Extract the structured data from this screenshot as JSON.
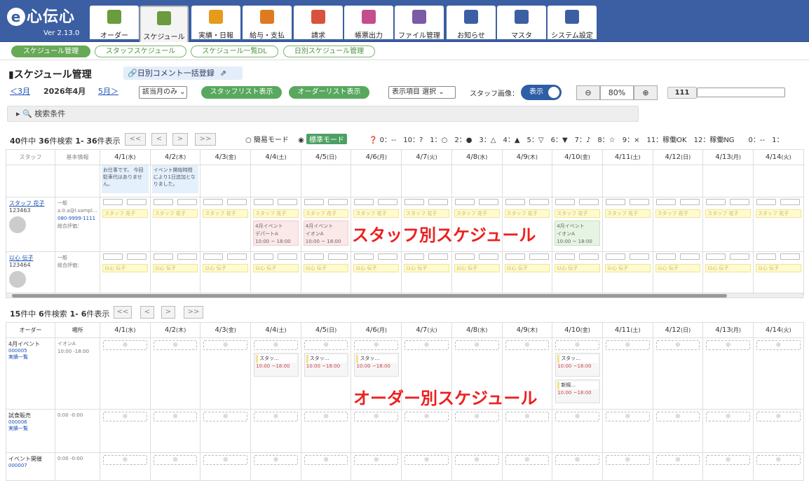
{
  "app": {
    "logo": "心伝心",
    "logo_e": "e",
    "version": "Ver 2.13.0"
  },
  "nav": [
    {
      "label": "オーダー",
      "icon": "handshake-icon"
    },
    {
      "label": "スケジュール",
      "icon": "calendar-icon"
    },
    {
      "label": "実績・日報",
      "icon": "book-icon"
    },
    {
      "label": "給与・支払",
      "icon": "person-money-icon"
    },
    {
      "label": "請求",
      "icon": "building-money-icon"
    },
    {
      "label": "帳票出力",
      "icon": "papers-icon"
    },
    {
      "label": "ファイル管理",
      "icon": "folder-icon"
    },
    {
      "label": "お知らせ",
      "icon": "bell-icon"
    },
    {
      "label": "マスタ",
      "icon": "database-icon"
    },
    {
      "label": "システム設定",
      "icon": "monitor-icon"
    }
  ],
  "subnav": [
    "スケジュール管理",
    "スタッフスケジュール",
    "スケジュール一覧DL",
    "日別スケジュール管理"
  ],
  "page": {
    "title": "スケジュール管理",
    "comment_btn": "日別コメント一括登録"
  },
  "toolbar": {
    "prev": "＜3月",
    "current": "2026年4月",
    "next": "5月＞",
    "filter": "該当月のみ",
    "staff_list_btn": "スタッフリスト表示",
    "order_list_btn": "オーダーリスト表示",
    "display_item": "表示項目 選択",
    "staff_image_label": "スタッフ画像：",
    "toggle": "表示",
    "zoom": "80%",
    "count_value": "111"
  },
  "search": {
    "label": "検索条件"
  },
  "staff_pager": {
    "total": "40",
    "found": "36",
    "range": "1- 36"
  },
  "order_pager": {
    "total": "15",
    "found": "6",
    "range": "1- 6"
  },
  "pager_text": {
    "prefix_suffix": "件中",
    "found_suffix": "件検索",
    "show_suffix": "件表示"
  },
  "pager_btns": [
    "<<",
    "<",
    ">",
    ">>"
  ],
  "modes": {
    "simple": "簡易モード",
    "standard": "標準モード"
  },
  "legend": "0：--　10：?　1：○　2：●　3：△　4：▲　5：▽　6：▼　7：♪　8：☆　9：×　11：稼働OK　12：稼働NG　　0：--　1：",
  "staff_table": {
    "headers": {
      "staff": "スタッフ",
      "info": "基本情報"
    },
    "dates": [
      {
        "d": "4/1",
        "w": "(水)",
        "t": ""
      },
      {
        "d": "4/2",
        "w": "(木)",
        "t": ""
      },
      {
        "d": "4/3",
        "w": "(金)",
        "t": ""
      },
      {
        "d": "4/4",
        "w": "(土)",
        "t": "sat"
      },
      {
        "d": "4/5",
        "w": "(日)",
        "t": "sun"
      },
      {
        "d": "4/6",
        "w": "(月)",
        "t": ""
      },
      {
        "d": "4/7",
        "w": "(火)",
        "t": ""
      },
      {
        "d": "4/8",
        "w": "(水)",
        "t": ""
      },
      {
        "d": "4/9",
        "w": "(木)",
        "t": ""
      },
      {
        "d": "4/10",
        "w": "(金)",
        "t": ""
      },
      {
        "d": "4/11",
        "w": "(土)",
        "t": "sat"
      },
      {
        "d": "4/12",
        "w": "(日)",
        "t": "sun"
      },
      {
        "d": "4/13",
        "w": "(月)",
        "t": ""
      },
      {
        "d": "4/14",
        "w": "(火)",
        "t": ""
      }
    ],
    "memos": {
      "d1": "お仕事です。\n今回駐車代はありません。",
      "d2": "イベント開始時間により1日追加となりました。"
    },
    "staff": [
      {
        "name": "スタッフ 花子",
        "id": "123463",
        "tag": "一般",
        "email": "a.0.a@l.sampl…",
        "tel": "080-9999-1111",
        "memo": "総合評価：",
        "chip": "スタッフ 花子"
      },
      {
        "name": "以心 伝子",
        "id": "123464",
        "tag": "一般",
        "email": "",
        "tel": "",
        "memo": "総合評価：",
        "chip": "以心 伝子"
      }
    ],
    "events": {
      "e1": {
        "title": "4月イベント",
        "place": "デパートA",
        "time": "10:00 ~ 18:00"
      },
      "e2": {
        "title": "4月イベント",
        "place": "イオンA",
        "time": "10:00 ~ 18:00"
      },
      "e3": {
        "title": "4月イベント",
        "place": "イオンA",
        "time": "10:00 ~ 18:00"
      }
    }
  },
  "order_table": {
    "headers": {
      "order": "オーダー",
      "place": "場所"
    },
    "orders": [
      {
        "name": "4月イベント",
        "code": "000005",
        "link": "実績一覧",
        "place": "イオンA",
        "time": "10:00 -18:00"
      },
      {
        "name": "試食販売",
        "code": "000006",
        "link": "実績一覧",
        "place": "",
        "time": "0:00 -0:00"
      },
      {
        "name": "イベント開催",
        "code": "000007",
        "link": "",
        "place": "",
        "time": "0:00 -0:00"
      }
    ],
    "chip": {
      "staff": "スタッ…",
      "staff2": "新規…",
      "time": "10:00 ~18:00"
    }
  },
  "annotations": {
    "staff": "スタッフ別スケジュール",
    "order": "オーダー別スケジュール"
  }
}
